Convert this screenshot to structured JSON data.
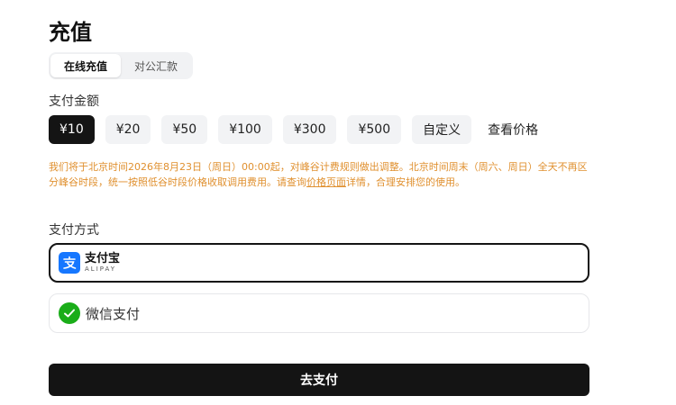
{
  "page": {
    "title": "充值"
  },
  "tabs": [
    {
      "label": "在线充值",
      "active": true
    },
    {
      "label": "对公汇款",
      "active": false
    }
  ],
  "amount_section": {
    "label": "支付金额",
    "options": [
      "¥10",
      "¥20",
      "¥50",
      "¥100",
      "¥300",
      "¥500",
      "自定义"
    ],
    "selected": "¥10",
    "price_link": "查看价格"
  },
  "notice": {
    "text_before": "我们将于北京时间2026年8月23日（周日）00:00起，对峰谷计费规则做出调整。北京时间周末（周六、周日）全天不再区分峰谷时段，统一按照低谷时段价格收取调用费用。请查询",
    "link": "价格页面",
    "text_after": "详情，合理安排您的使用。",
    "color": "#e0902f"
  },
  "payment_section": {
    "label": "支付方式",
    "methods": [
      {
        "name": "支付宝",
        "subtitle": "ALIPAY",
        "icon": "alipay-icon",
        "selected": true,
        "color": "#1677ff"
      },
      {
        "name": "微信支付",
        "icon": "wechat-icon",
        "selected": false,
        "color": "#1aad19"
      }
    ]
  },
  "pay_button": {
    "label": "去支付"
  }
}
